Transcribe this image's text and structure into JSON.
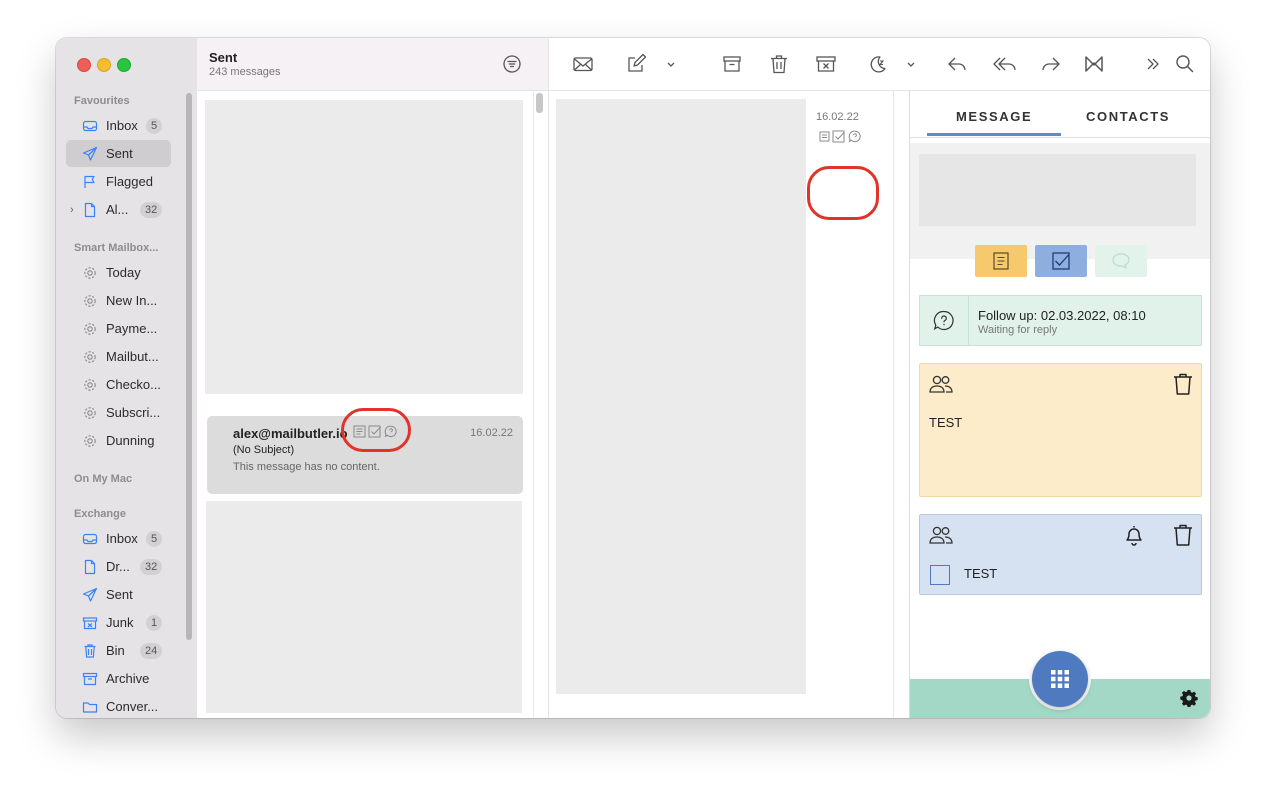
{
  "sidebar": {
    "sections": [
      {
        "title": "Favourites"
      },
      {
        "title": "Smart Mailbox..."
      },
      {
        "title": "On My Mac"
      },
      {
        "title": "Exchange"
      }
    ],
    "favourites": [
      {
        "label": "Inbox",
        "badge": "5",
        "icon": "inbox-icon"
      },
      {
        "label": "Sent",
        "badge": "",
        "icon": "paperplane-icon",
        "selected": true
      },
      {
        "label": "Flagged",
        "badge": "",
        "icon": "flag-icon"
      },
      {
        "label": "Al...",
        "badge": "32",
        "icon": "document-icon",
        "expandable": true
      }
    ],
    "smart_mailboxes": [
      {
        "label": "Today",
        "icon": "gear-icon"
      },
      {
        "label": "New In...",
        "icon": "gear-icon"
      },
      {
        "label": "Payme...",
        "icon": "gear-icon"
      },
      {
        "label": "Mailbut...",
        "icon": "gear-icon"
      },
      {
        "label": "Checko...",
        "icon": "gear-icon"
      },
      {
        "label": "Subscri...",
        "icon": "gear-icon"
      },
      {
        "label": "Dunning",
        "icon": "gear-icon"
      }
    ],
    "exchange": [
      {
        "label": "Inbox",
        "badge": "5",
        "icon": "inbox-icon"
      },
      {
        "label": "Dr...",
        "badge": "32",
        "icon": "document-icon"
      },
      {
        "label": "Sent",
        "badge": "",
        "icon": "paperplane-icon"
      },
      {
        "label": "Junk",
        "badge": "1",
        "icon": "junk-icon"
      },
      {
        "label": "Bin",
        "badge": "24",
        "icon": "trash-icon"
      },
      {
        "label": "Archive",
        "badge": "",
        "icon": "archive-icon"
      },
      {
        "label": "Conver...",
        "badge": "",
        "icon": "folder-icon"
      }
    ]
  },
  "list": {
    "title": "Sent",
    "count": "243 messages",
    "message": {
      "from": "alex@mailbutler.io",
      "date": "16.02.22",
      "subject": "(No Subject)",
      "preview": "This message has no content."
    }
  },
  "toolbar": {
    "buttons": [
      "get-mail-icon",
      "compose-icon",
      "chevron-down-icon",
      "archive-icon",
      "trash-icon",
      "junk-icon",
      "snooze-icon",
      "chevron-down-icon",
      "reply-icon",
      "reply-all-icon",
      "forward-icon",
      "mailbutler-icon",
      "more-icon",
      "search-icon"
    ]
  },
  "viewer": {
    "date": "16.02.22"
  },
  "panel": {
    "tabs": [
      {
        "label": "MESSAGE",
        "active": true
      },
      {
        "label": "CONTACTS",
        "active": false
      }
    ],
    "followup": {
      "title": "Follow up: 02.03.2022, 08:10",
      "subtitle": "Waiting for reply"
    },
    "note": {
      "text": "TEST"
    },
    "task": {
      "text": "TEST",
      "checked": false
    }
  },
  "colors": {
    "accent_blue": "#4f7ac0",
    "note_yellow": "#fcecca",
    "task_blue": "#d6e2f1",
    "followup_green": "#e1f2ea",
    "footer_green": "#a4d8c6",
    "highlight_red": "#e0342b"
  }
}
